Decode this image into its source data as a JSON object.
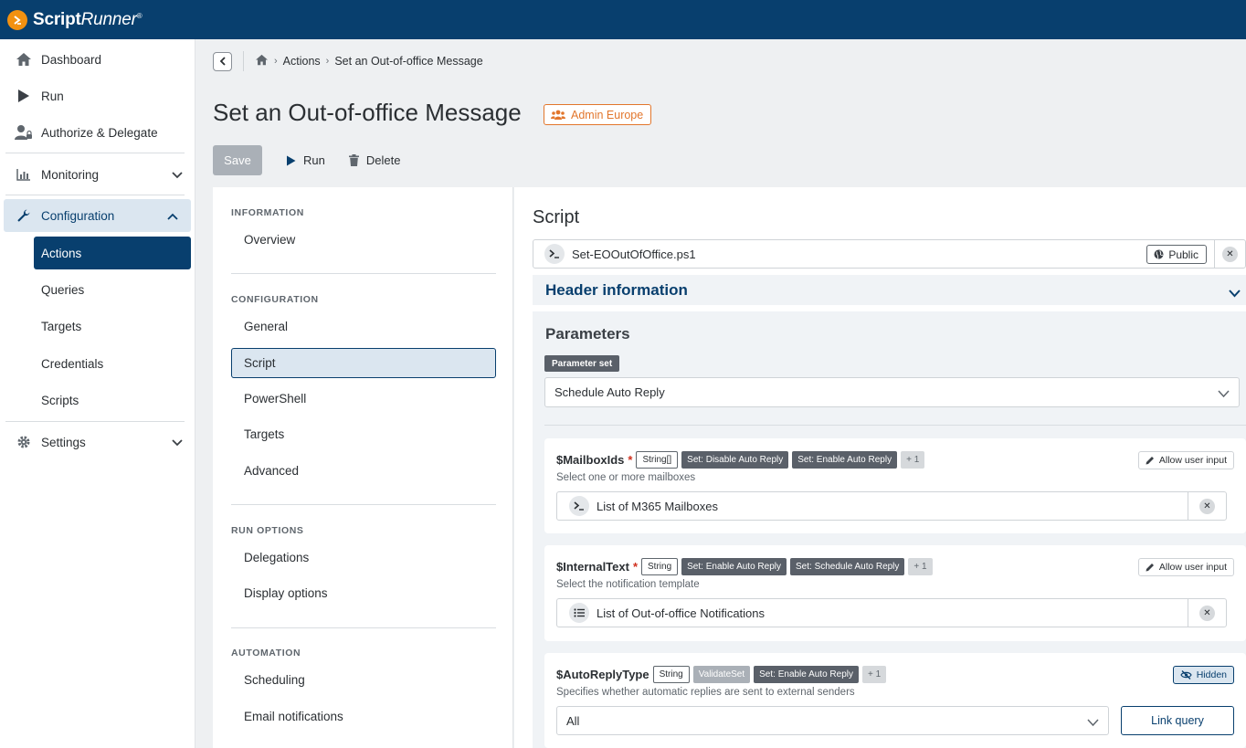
{
  "app": {
    "logo_prefix": "Script",
    "logo_suffix": "Runner",
    "logo_mark": "®"
  },
  "sidebar": {
    "items": [
      {
        "label": "Dashboard",
        "icon": "home-icon"
      },
      {
        "label": "Run",
        "icon": "play-icon"
      },
      {
        "label": "Authorize & Delegate",
        "icon": "user-lock-icon"
      },
      {
        "label": "Monitoring",
        "icon": "chart-icon"
      },
      {
        "label": "Configuration",
        "icon": "wrench-icon"
      },
      {
        "label": "Settings",
        "icon": "gear-icon"
      }
    ],
    "config_sub": [
      "Actions",
      "Queries",
      "Targets",
      "Credentials",
      "Scripts"
    ]
  },
  "breadcrumb": {
    "items": [
      "Actions",
      "Set an Out-of-office Message"
    ]
  },
  "page": {
    "title": "Set an Out-of-office Message",
    "owner_badge": "Admin Europe"
  },
  "toolbar": {
    "save": "Save",
    "run": "Run",
    "delete": "Delete"
  },
  "inner_nav": {
    "sections": [
      {
        "head": "INFORMATION",
        "items": [
          "Overview"
        ]
      },
      {
        "head": "CONFIGURATION",
        "items": [
          "General",
          "Script",
          "PowerShell",
          "Targets",
          "Advanced"
        ]
      },
      {
        "head": "RUN OPTIONS",
        "items": [
          "Delegations",
          "Display options"
        ]
      },
      {
        "head": "AUTOMATION",
        "items": [
          "Scheduling",
          "Email notifications"
        ]
      }
    ]
  },
  "script": {
    "heading": "Script",
    "file": "Set-EOOutOfOffice.ps1",
    "visibility": "Public",
    "header_info": "Header information"
  },
  "params": {
    "heading": "Parameters",
    "set_label": "Parameter set",
    "set_value": "Schedule Auto Reply",
    "cards": [
      {
        "name": "$MailboxIds",
        "required": "*",
        "tags": [
          "String[]",
          "Set: Disable Auto Reply",
          "Set: Enable Auto Reply",
          "+ 1"
        ],
        "action": "Allow user input",
        "hint": "Select one or more mailboxes",
        "value": "List of M365 Mailboxes"
      },
      {
        "name": "$InternalText",
        "required": "*",
        "tags": [
          "String",
          "Set: Enable Auto Reply",
          "Set: Schedule Auto Reply",
          "+ 1"
        ],
        "action": "Allow user input",
        "hint": "Select the notification template",
        "value": "List of Out-of-office Notifications"
      },
      {
        "name": "$AutoReplyType",
        "tags": [
          "String",
          "ValidateSet",
          "Set: Enable Auto Reply",
          "+ 1"
        ],
        "action": "Hidden",
        "hint": "Specifies whether automatic replies are sent to external senders",
        "value": "All",
        "link": "Link query"
      }
    ]
  },
  "colors": {
    "brand": "#083f6e",
    "accent": "#f29111",
    "owner": "#e2762c",
    "required": "#d0301e"
  }
}
